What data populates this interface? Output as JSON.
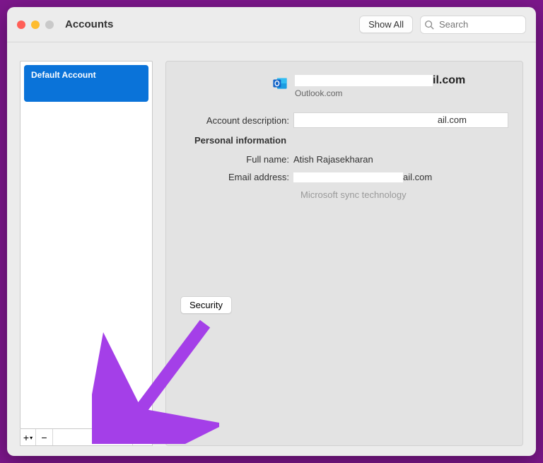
{
  "window": {
    "title": "Accounts"
  },
  "toolbar": {
    "show_all": "Show All",
    "search_placeholder": "Search"
  },
  "sidebar": {
    "items": [
      {
        "label": "Default Account"
      }
    ],
    "controls": {
      "add": "+",
      "remove": "−"
    }
  },
  "details": {
    "email_suffix": "il.com",
    "account_type": "Outlook.com",
    "labels": {
      "description": "Account description:",
      "personal_info": "Personal information",
      "full_name": "Full name:",
      "email": "Email address:"
    },
    "values": {
      "description_suffix": "ail.com",
      "full_name": "Atish Rajasekharan",
      "email_suffix": "ail.com",
      "sync_note": "Microsoft sync technology"
    },
    "security_button": "Security"
  }
}
